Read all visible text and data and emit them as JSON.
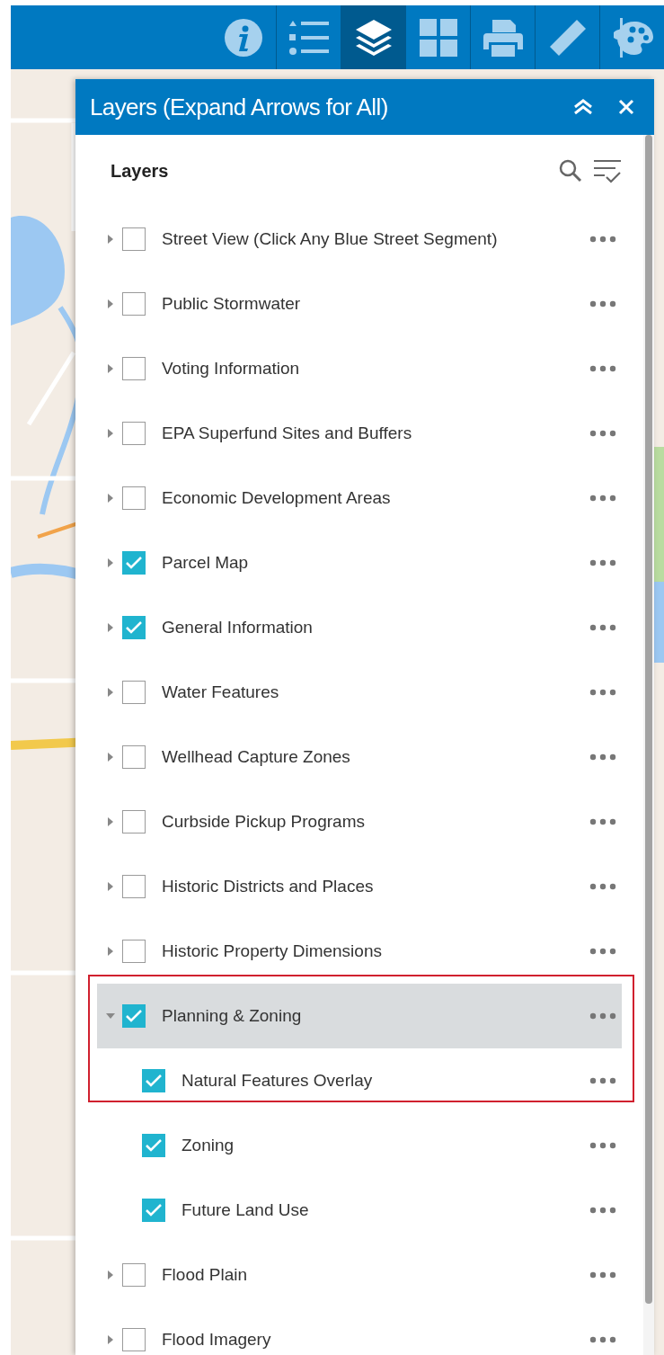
{
  "toolbar": {
    "tools": [
      {
        "kind": "info",
        "selected": false
      },
      {
        "kind": "legend",
        "selected": false
      },
      {
        "kind": "layers",
        "selected": true
      },
      {
        "kind": "basemap",
        "selected": false
      },
      {
        "kind": "print",
        "selected": false
      },
      {
        "kind": "measure",
        "selected": false
      },
      {
        "kind": "style",
        "selected": false
      }
    ]
  },
  "panel": {
    "title": "Layers (Expand Arrows for All)",
    "heading": "Layers",
    "layers": [
      {
        "label": "Street View (Click Any Blue Street Segment)",
        "checked": false,
        "expanded": false,
        "selected": false,
        "outlined": false
      },
      {
        "label": "Public Stormwater",
        "checked": false,
        "expanded": false,
        "selected": false,
        "outlined": false
      },
      {
        "label": "Voting Information",
        "checked": false,
        "expanded": false,
        "selected": false,
        "outlined": false
      },
      {
        "label": "EPA Superfund Sites and Buffers",
        "checked": false,
        "expanded": false,
        "selected": false,
        "outlined": false
      },
      {
        "label": "Economic Development Areas",
        "checked": false,
        "expanded": false,
        "selected": false,
        "outlined": false
      },
      {
        "label": "Parcel Map",
        "checked": true,
        "expanded": false,
        "selected": false,
        "outlined": false
      },
      {
        "label": "General Information",
        "checked": true,
        "expanded": false,
        "selected": false,
        "outlined": false
      },
      {
        "label": "Water Features",
        "checked": false,
        "expanded": false,
        "selected": false,
        "outlined": false
      },
      {
        "label": "Wellhead Capture Zones",
        "checked": false,
        "expanded": false,
        "selected": false,
        "outlined": false
      },
      {
        "label": "Curbside Pickup Programs",
        "checked": false,
        "expanded": false,
        "selected": false,
        "outlined": false
      },
      {
        "label": "Historic Districts and Places",
        "checked": false,
        "expanded": false,
        "selected": false,
        "outlined": false
      },
      {
        "label": "Historic Property Dimensions",
        "checked": false,
        "expanded": false,
        "selected": false,
        "outlined": false
      },
      {
        "label": "Planning & Zoning",
        "checked": true,
        "expanded": true,
        "selected": true,
        "outlined": true,
        "children": [
          {
            "label": "Natural Features Overlay",
            "checked": true,
            "selected": false,
            "outlined": true
          },
          {
            "label": "Zoning",
            "checked": true,
            "selected": false,
            "outlined": false
          },
          {
            "label": "Future Land Use",
            "checked": true,
            "selected": false,
            "outlined": false
          }
        ]
      },
      {
        "label": "Flood Plain",
        "checked": false,
        "expanded": false,
        "selected": false,
        "outlined": false
      },
      {
        "label": "Flood Imagery",
        "checked": false,
        "expanded": false,
        "selected": false,
        "outlined": false
      }
    ]
  }
}
